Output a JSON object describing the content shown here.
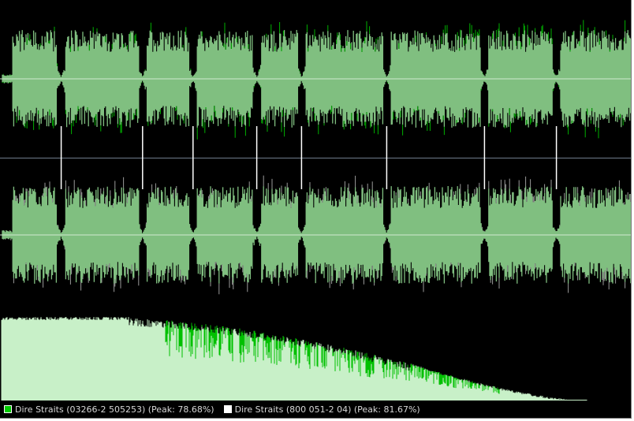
{
  "colors": {
    "background": "#000000",
    "waveform_fill": "#80bf80",
    "waveform_peak_a": "#00b000",
    "waveform_peak_b": "#9a9a9a",
    "divider": "#6f7c8c",
    "spectrum_fill": "#c8f0c8",
    "spectrum_peak": "#00c000",
    "track_b_marker": "#ffffff"
  },
  "legend": {
    "track_a": {
      "label": "Dire Straits (03266-2 505253) (Peak: 78.68%)",
      "swatch_color": "#00cc00"
    },
    "track_b": {
      "label": "Dire Straits (800 051-2 04) (Peak: 81.67%)",
      "swatch_color": "#ffffff"
    }
  },
  "track_gaps": [
    0.097,
    0.226,
    0.306,
    0.407,
    0.478,
    0.613,
    0.768,
    0.882
  ]
}
